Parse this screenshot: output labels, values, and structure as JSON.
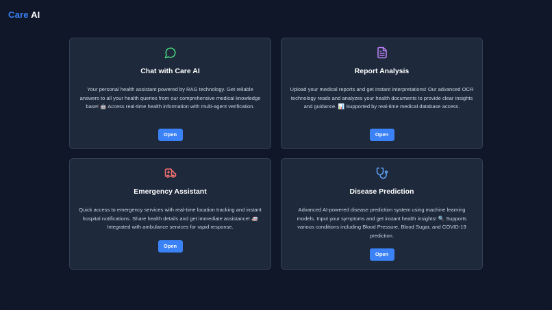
{
  "brand": {
    "part1": "Care",
    "part2": "AI"
  },
  "colors": {
    "background": "#0f1729",
    "card": "#1e293b",
    "accent": "#3b82f6",
    "chat_icon": "#4ade80",
    "report_icon": "#c084fc",
    "emergency_icon": "#f87171",
    "disease_icon": "#60a5fa"
  },
  "cards": [
    {
      "icon": "chat-bubble-icon",
      "title": "Chat with Care AI",
      "description": "Your personal health assistant powered by RAG technology. Get reliable answers to all your health queries from our comprehensive medical knowledge base! 🤖 Access real-time health information with multi-agent verification.",
      "button": "Open"
    },
    {
      "icon": "document-icon",
      "title": "Report Analysis",
      "description": "Upload your medical reports and get instant interpretations! Our advanced OCR technology reads and analyzes your health documents to provide clear insights and guidance. 📊 Supported by real-time medical database access.",
      "button": "Open"
    },
    {
      "icon": "ambulance-icon",
      "title": "Emergency Assistant",
      "description": "Quick access to emergency services with real-time location tracking and instant hospital notifications. Share health details and get immediate assistance! 🚑 Integrated with ambulance services for rapid response.",
      "button": "Open"
    },
    {
      "icon": "stethoscope-icon",
      "title": "Disease Prediction",
      "description": "Advanced AI-powered disease prediction system using machine learning models. Input your symptoms and get instant health insights! 🔍 Supports various conditions including Blood Pressure, Blood Sugar, and COVID-19 prediction.",
      "button": "Open"
    }
  ]
}
